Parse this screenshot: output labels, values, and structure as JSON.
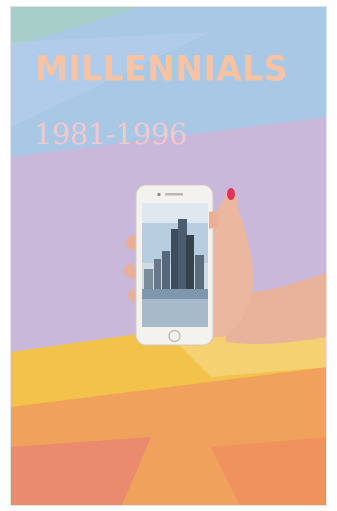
{
  "poster": {
    "title": "MILLENNIALS",
    "years": "1981-1996"
  },
  "colors": {
    "title": "#f7c3a3",
    "years": "#f3c7cc",
    "band_blue": "#a9c8e6",
    "band_lavender": "#c9b8d9",
    "band_green": "#a7d6a0",
    "band_yellow": "#f2c24a",
    "band_orange": "#f0a15b",
    "band_coral": "#ea8a6f",
    "phone_body": "#f4f2ee",
    "nail": "#e2345a"
  },
  "icons": [
    "smartphone-image",
    "hand-image",
    "city-skyline-image"
  ]
}
